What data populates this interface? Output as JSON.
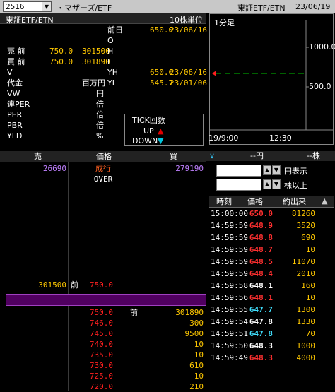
{
  "header": {
    "code": "2516",
    "name": "・マザーズ/ETF",
    "market": "東証ETF/ETN",
    "date": "23/06/19"
  },
  "subheader": {
    "market": "東証ETF/ETN",
    "unit": "10株単位"
  },
  "quote": {
    "prev_label": "前日",
    "prev_value": "650.0",
    "prev_date": "23/06/16",
    "o_label": "O",
    "ask_label": "売 前",
    "ask_price": "750.0",
    "ask_qty": "301500",
    "h_label": "H",
    "bid_label": "買 前",
    "bid_price": "750.0",
    "bid_qty": "301890",
    "l_label": "L",
    "v_label": "V",
    "yh_label": "YH",
    "yh_value": "650.0",
    "yh_date": "23/06/16",
    "amt_label": "代金",
    "amt_unit": "百万円",
    "yl_label": "YL",
    "yl_value": "545.7",
    "yl_date": "23/01/06",
    "vw_label": "VW",
    "vw_unit": "円",
    "per2_label": "連PER",
    "per2_unit": "倍",
    "per_label": "PER",
    "per_unit": "倍",
    "pbr_label": "PBR",
    "pbr_unit": "倍",
    "yld_label": "YLD",
    "yld_unit": "%"
  },
  "chart": {
    "period": "1分足",
    "y_top": "1000.0",
    "y_mid": "500.0",
    "x_left": "19/9:00",
    "x_right": "12:30",
    "level": 0.65,
    "color_line": "#00c000"
  },
  "tick": {
    "title": "TICK回数",
    "up": "UP",
    "down": "DOWN",
    "up_color": "#e00000",
    "down_color": "#00c8e0"
  },
  "orderbook": {
    "headers": {
      "sell": "売",
      "price": "価格",
      "buy": "買"
    },
    "top": {
      "sell": "26690",
      "price": "成行",
      "buy": "279190"
    },
    "over": "OVER",
    "ask_row": {
      "qty": "301500",
      "mark": "前",
      "price": "750.0"
    },
    "bids": [
      {
        "price": "750.0",
        "mark": "前",
        "qty": "301890"
      },
      {
        "price": "746.0",
        "qty": "300"
      },
      {
        "price": "745.0",
        "qty": "9500"
      },
      {
        "price": "740.0",
        "qty": "10"
      },
      {
        "price": "735.0",
        "qty": "10"
      },
      {
        "price": "730.0",
        "qty": "610"
      },
      {
        "price": "725.0",
        "qty": "10"
      },
      {
        "price": "720.0",
        "qty": "210"
      }
    ]
  },
  "ticks_panel": {
    "filter_unit": "--円",
    "filter_share": "--株",
    "yen_label": "円表示",
    "share_label": "株以上",
    "headers": {
      "time": "時刻",
      "price": "価格",
      "vol": "約出来"
    },
    "rows": [
      {
        "time": "15:00:00",
        "price": "650.0",
        "vol": "81260",
        "pc": "#ff3030"
      },
      {
        "time": "14:59:59",
        "price": "648.9",
        "vol": "3520",
        "pc": "#ff3030"
      },
      {
        "time": "14:59:59",
        "price": "648.8",
        "vol": "690",
        "pc": "#ff3030"
      },
      {
        "time": "14:59:59",
        "price": "648.7",
        "vol": "10",
        "pc": "#ff3030"
      },
      {
        "time": "14:59:59",
        "price": "648.5",
        "vol": "11070",
        "pc": "#ff3030"
      },
      {
        "time": "14:59:59",
        "price": "648.4",
        "vol": "2010",
        "pc": "#ff3030"
      },
      {
        "time": "14:59:58",
        "price": "648.1",
        "vol": "160",
        "pc": "#ffffff"
      },
      {
        "time": "14:59:56",
        "price": "648.1",
        "vol": "10",
        "pc": "#ff3030"
      },
      {
        "time": "14:59:55",
        "price": "647.7",
        "vol": "1300",
        "pc": "#40e0ff"
      },
      {
        "time": "14:59:54",
        "price": "647.8",
        "vol": "1330",
        "pc": "#ffffff"
      },
      {
        "time": "14:59:51",
        "price": "647.8",
        "vol": "70",
        "pc": "#40e0ff"
      },
      {
        "time": "14:59:50",
        "price": "648.3",
        "vol": "1000",
        "pc": "#ffffff"
      },
      {
        "time": "14:59:49",
        "price": "648.3",
        "vol": "4000",
        "pc": "#ff3030"
      }
    ]
  }
}
